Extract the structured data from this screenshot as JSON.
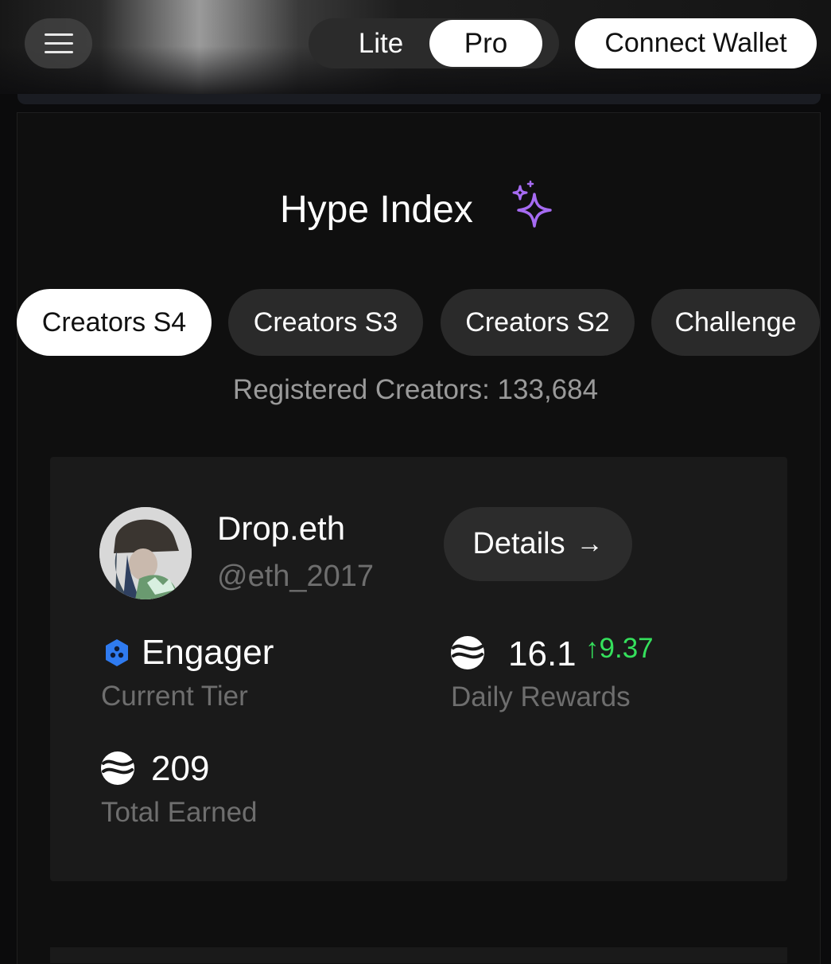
{
  "header": {
    "menu_icon": "hamburger-icon",
    "mode_toggle": {
      "options": [
        "Lite",
        "Pro"
      ],
      "selected": "Pro"
    },
    "connect_label": "Connect Wallet"
  },
  "main": {
    "title": "Hype Index",
    "title_icon": "sparkles-icon",
    "tabs": [
      {
        "label": "Creators S4",
        "active": true
      },
      {
        "label": "Creators S3",
        "active": false
      },
      {
        "label": "Creators S2",
        "active": false
      },
      {
        "label": "Challenge",
        "active": false
      }
    ],
    "registered_text": "Registered Creators: 133,684"
  },
  "profile": {
    "name": "Drop.eth",
    "handle": "@eth_2017",
    "details_label": "Details",
    "details_icon": "arrow-right-icon",
    "tier": {
      "name": "Engager",
      "label": "Current Tier",
      "icon": "hexagon-tier-icon",
      "color": "#2f7bf0"
    },
    "daily": {
      "value": "16.1",
      "delta": "9.37",
      "label": "Daily Rewards",
      "delta_color": "#35e05c"
    },
    "total": {
      "value": "209",
      "label": "Total Earned"
    }
  },
  "colors": {
    "accent_purple": "#a66bf2",
    "positive": "#35e05c",
    "tier_blue": "#2f7bf0"
  }
}
